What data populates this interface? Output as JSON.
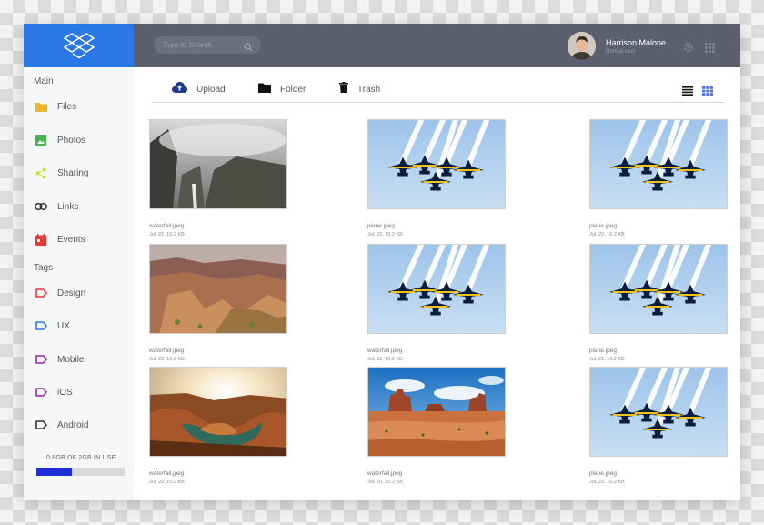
{
  "sidebar": {
    "main_title": "Main",
    "main_items": [
      {
        "label": "Files",
        "icon": "folder-icon",
        "color": "#f0b429"
      },
      {
        "label": "Photos",
        "icon": "image-icon",
        "color": "#4caf50"
      },
      {
        "label": "Sharing",
        "icon": "share-icon",
        "color": "#cddc39"
      },
      {
        "label": "Links",
        "icon": "link-icon",
        "color": "#333333"
      },
      {
        "label": "Events",
        "icon": "calendar-icon",
        "color": "#e53935"
      }
    ],
    "tags_title": "Tags",
    "tags": [
      {
        "label": "Design",
        "color": "#e53935"
      },
      {
        "label": "UX",
        "color": "#2a78e6"
      },
      {
        "label": "Mobile",
        "color": "#9c27b0"
      },
      {
        "label": "iOS",
        "color": "#9c27b0"
      },
      {
        "label": "Android",
        "color": "#333333"
      }
    ],
    "usage": {
      "label": "0.8GB OF 2GB IN USE",
      "fraction": 0.4,
      "color": "#1f2fd6"
    }
  },
  "header": {
    "search_placeholder": "Type to Search",
    "user_name": "Harrison Malone",
    "user_role": "Normal user"
  },
  "toolbar": {
    "upload_label": "Upload",
    "folder_label": "Folder",
    "trash_label": "Trash"
  },
  "files": [
    {
      "name": "waterfall.jpeg",
      "meta": "Jul, 22, 10.2 KB",
      "image": "waterfall"
    },
    {
      "name": "plane.jpeg",
      "meta": "Jul, 22, 10.2 KB",
      "image": "planes"
    },
    {
      "name": "plane.jpeg",
      "meta": "Jul, 22, 10.2 KB",
      "image": "planes"
    },
    {
      "name": "waterfall.jpeg",
      "meta": "Jul, 22, 10.2 KB",
      "image": "canyon"
    },
    {
      "name": "waterfall.jpeg",
      "meta": "Jul, 22, 10.2 KB",
      "image": "planes"
    },
    {
      "name": "plane.jpeg",
      "meta": "Jul, 22, 10.2 KB",
      "image": "planes"
    },
    {
      "name": "waterfall.jpeg",
      "meta": "Jul, 22, 10.2 KB",
      "image": "horseshoe"
    },
    {
      "name": "waterfall.jpeg",
      "meta": "Jul, 20, 10.2 KB",
      "image": "monument"
    },
    {
      "name": "plane.jpeg",
      "meta": "Jul, 22, 10.2 KB",
      "image": "planes"
    }
  ]
}
